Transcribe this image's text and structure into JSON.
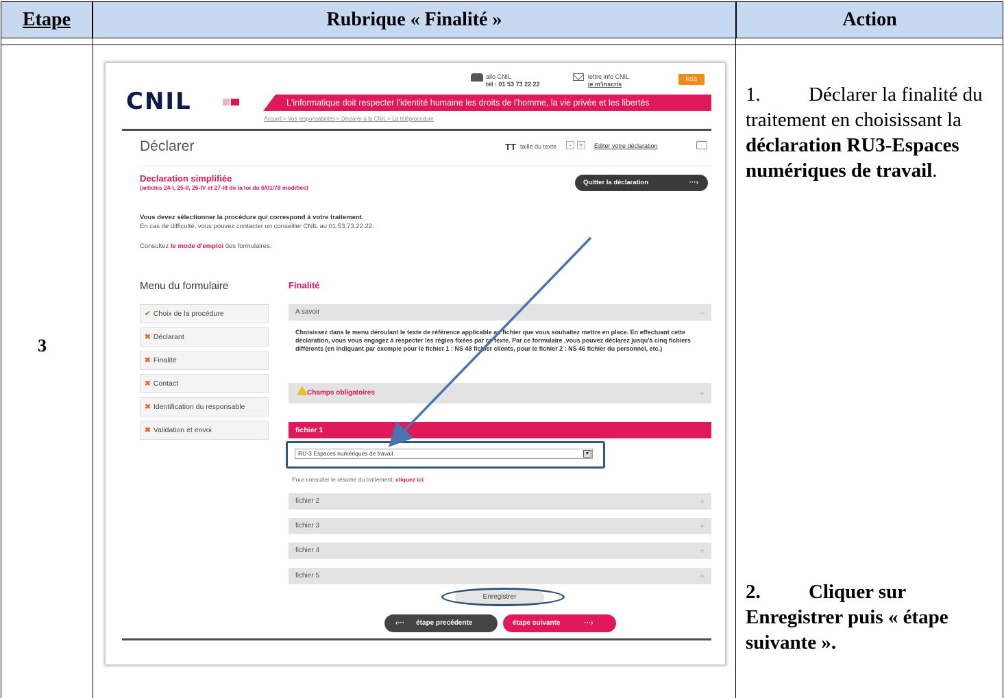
{
  "table": {
    "headers": {
      "etape": "Etape",
      "rubrique": "Rubrique « Finalité »",
      "action": "Action"
    },
    "step_number": "3",
    "action1": {
      "num": "1.",
      "text_plain": "Déclarer la finalité du traitement en choisissant la ",
      "text_bold": "déclaration RU3-Espaces numériques de travail",
      "end": "."
    },
    "action2": {
      "num": "2.",
      "text": "Cliquer sur Enregistrer puis « étape suivante »."
    }
  },
  "site": {
    "logo": "CNIL",
    "allo": "allo CNIL",
    "tel": "tél : 01 53 73 22 22",
    "lettre": "lettre info CNIL",
    "inscris": "je m'inscris",
    "rss": "RSS",
    "banner": "L'informatique doit respecter l'identité humaine les droits de l'homme, la vie privée et les libertés",
    "breadcrumb": "Accueil > Vos responsabilités > Déclarer à la CNIL > La téléprocédure",
    "page_title": "Déclarer",
    "text_size_label": "taille du texte",
    "tt": "TT",
    "minus": "-",
    "plus": "+",
    "edit_link": "Editer votre déclaration",
    "decl_title": "Declaration simplifiée",
    "decl_sub": "(articles 24-I, 25-II, 26-IV et 27-III de la loi du 6/01/78 modifiée)",
    "quit_button": "Quitter la déclaration",
    "quit_arrow": "···›",
    "intro1": "Vous devez sélectionner la procédure qui correspond à votre traitement.",
    "intro2": "En cas de difficulté, vous pouvez contacter un conseiller CNIL au 01.53.73.22.22.",
    "intro3_a": "Consultez ",
    "intro3_link": "le mode d'emploi",
    "intro3_b": " des formulaires.",
    "menu_title": "Menu du formulaire",
    "menu_items": [
      {
        "label": "Choix de la procédure",
        "mark": "✔"
      },
      {
        "label": "Déclarant",
        "mark": "✖"
      },
      {
        "label": "Finalité",
        "mark": "✖"
      },
      {
        "label": "Contact",
        "mark": "✖"
      },
      {
        "label": "Identification du responsable",
        "mark": "✖"
      },
      {
        "label": "Validation et envoi",
        "mark": "✖"
      }
    ],
    "finalite_title": "Finalité",
    "asavoir": "A savoir",
    "asavoir_toggle": "–",
    "asavoir_text": "Choisissez dans le menu déroulant le texte de référence applicable au fichier que vous souhaitez mettre en place. En effectuant cette déclaration, vous vous engagez à respecter les règles fixées par ce texte. Par ce formulaire ,vous pouvez déclarez jusqu'à cinq fichiers différents (en indiquant par exemple pour le fichier 1 : NS 48 fichier clients, pour le fichier 2 : NS 46 fichier du personnel, etc.)",
    "champs": "Champs obligatoires",
    "fichier1": "fichier 1",
    "select_value": "RU-3 Espaces numériques de travail",
    "resume_a": "Pour consulter le résumé du traitement, ",
    "resume_link": "cliquez ici",
    "fichiers": [
      "fichier 2",
      "fichier 3",
      "fichier 4",
      "fichier 5"
    ],
    "expand": "+",
    "save_button": "Enregistrer",
    "prev_button": "étape precédente",
    "prev_arrow": "‹···",
    "next_button": "étape suivante",
    "next_arrow": "···›"
  },
  "colors": {
    "header_bg": "#c6d9f1",
    "cnil_pink": "#e0195a",
    "annotation_blue": "#33557a"
  }
}
